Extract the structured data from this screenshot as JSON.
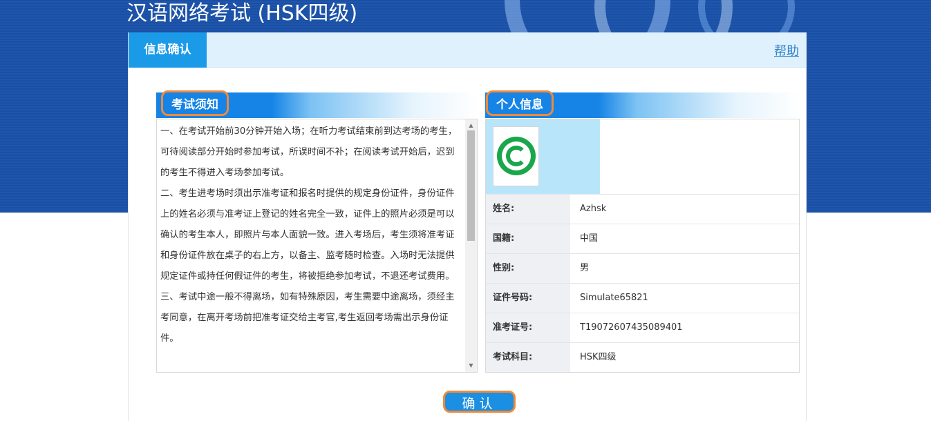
{
  "app": {
    "title": "汉语网络考试 (HSK四级)"
  },
  "tabs": {
    "active_label": "信息确认",
    "help_label": "帮助"
  },
  "notice": {
    "title": "考试须知",
    "paragraphs": [
      "一、在考试开始前30分钟开始入场；在听力考试结束前到达考场的考生，可待阅读部分开始时参加考试，所误时间不补；在阅读考试开始后，迟到的考生不得进入考场参加考试。",
      "二、考生进考场时须出示准考证和报名时提供的规定身份证件，身份证件上的姓名必须与准考证上登记的姓名完全一致，证件上的照片必须是可以确认的考生本人，即照片与本人面貌一致。进入考场后，考生须将准考证和身份证件放在桌子的右上方，以备主、监考随时检查。入场时无法提供规定证件或持任何假证件的考生，将被拒绝参加考试，不退还考试费用。",
      "三、考试中途一般不得离场，如有特殊原因，考生需要中途离场，须经主考同意，在离开考场前把准考证交给主考官,考生返回考场需出示身份证件。"
    ]
  },
  "personal": {
    "title": "个人信息",
    "rows": [
      {
        "label": "姓名:",
        "value": "Azhsk"
      },
      {
        "label": "国籍:",
        "value": "中国"
      },
      {
        "label": "性别:",
        "value": "男"
      },
      {
        "label": "证件号码:",
        "value": "Simulate65821"
      },
      {
        "label": "准考证号:",
        "value": "T19072607435089401"
      },
      {
        "label": "考试科目:",
        "value": "HSK四级"
      }
    ]
  },
  "actions": {
    "confirm_label": "确认"
  },
  "colors": {
    "banner": "#1f56ad",
    "accent": "#1b9ae8",
    "highlight_border": "#f08a3a"
  }
}
